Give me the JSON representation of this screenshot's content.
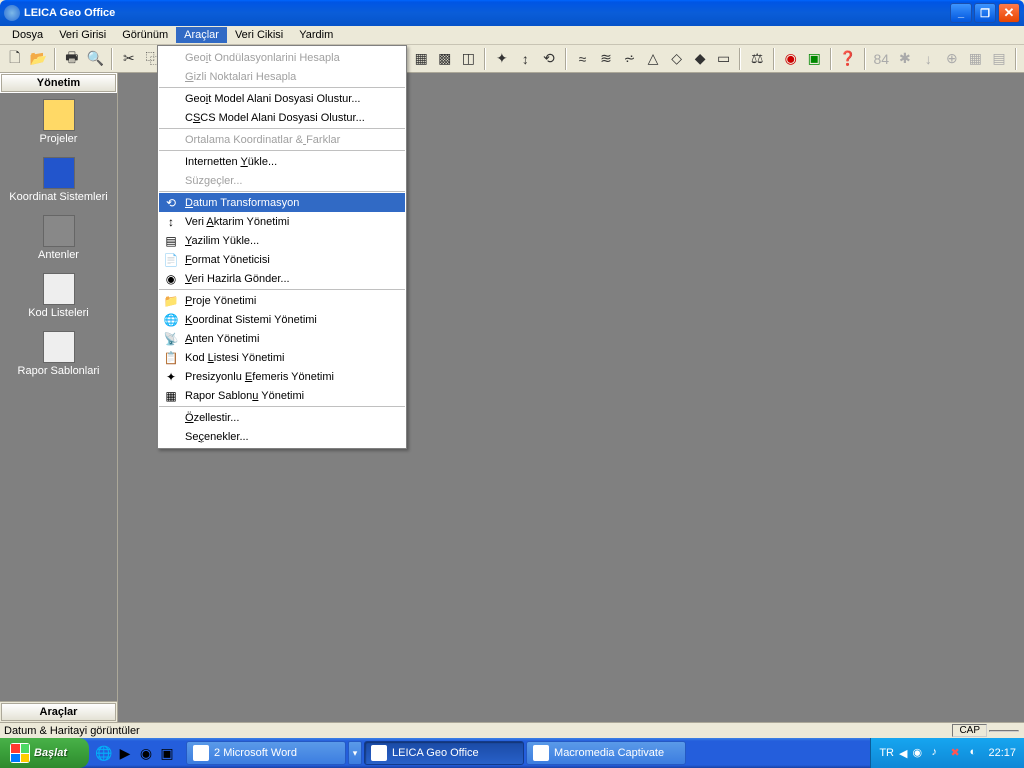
{
  "titlebar": {
    "title": "LEICA Geo Office"
  },
  "menubar": {
    "items": [
      "Dosya",
      "Veri Girisi",
      "Görünüm",
      "Araçlar",
      "Veri Cikisi",
      "Yardim"
    ],
    "activeIndex": 3
  },
  "sidebar": {
    "header": "Yönetim",
    "items": [
      {
        "label": "Projeler"
      },
      {
        "label": "Koordinat Sistemleri"
      },
      {
        "label": "Antenler"
      },
      {
        "label": "Kod Listeleri"
      },
      {
        "label": "Rapor Sablonlari"
      }
    ],
    "footer": "Araçlar"
  },
  "dropdown": {
    "groups": [
      [
        {
          "label": "Geoit Ondülasyonlarini Hesapla",
          "disabled": true,
          "u": 3
        },
        {
          "label": "Gizli Noktalari Hesapla",
          "disabled": true,
          "u": 0
        }
      ],
      [
        {
          "label": "Geoit Model Alani Dosyasi Olustur...",
          "u": 3
        },
        {
          "label": "CSCS Model Alani Dosyasi Olustur...",
          "u": 1
        }
      ],
      [
        {
          "label": "Ortalama Koordinatlar & Farklar",
          "disabled": true,
          "u": 23
        }
      ],
      [
        {
          "label": "Internetten Yükle...",
          "u": 12
        },
        {
          "label": "Süzgeçler...",
          "disabled": true
        }
      ],
      [
        {
          "label": "Datum Transformasyon",
          "highlight": true,
          "u": 0,
          "icon": "⟲"
        },
        {
          "label": "Veri Aktarim Yönetimi",
          "u": 5,
          "icon": "↕"
        },
        {
          "label": "Yazilim Yükle...",
          "u": 0,
          "icon": "▤"
        },
        {
          "label": "Format Yöneticisi",
          "u": 0,
          "icon": "📄"
        },
        {
          "label": "Veri Hazirla Gönder...",
          "u": 0,
          "icon": "◉"
        }
      ],
      [
        {
          "label": "Proje Yönetimi",
          "u": 0,
          "icon": "📁"
        },
        {
          "label": "Koordinat Sistemi Yönetimi",
          "u": 0,
          "icon": "🌐"
        },
        {
          "label": "Anten Yönetimi",
          "u": 0,
          "icon": "📡"
        },
        {
          "label": "Kod Listesi Yönetimi",
          "u": 4,
          "icon": "📋"
        },
        {
          "label": "Presizyonlu Efemeris Yönetimi",
          "u": 12,
          "icon": "✦"
        },
        {
          "label": "Rapor Sablonu Yönetimi",
          "u": 12,
          "icon": "▦"
        }
      ],
      [
        {
          "label": "Özellestir...",
          "u": 0
        },
        {
          "label": "Seçenekler...",
          "u": 2
        }
      ]
    ]
  },
  "statusbar": {
    "text": "Datum & Haritayi görüntüler",
    "cap": "CAP"
  },
  "taskbar": {
    "start": "Başlat",
    "tasks": [
      {
        "label": "2 Microsoft Word",
        "hasDrop": true
      },
      {
        "label": "LEICA Geo Office",
        "active": true
      },
      {
        "label": "Macromedia Captivate"
      }
    ],
    "lang": "TR",
    "clock": "22:17"
  }
}
